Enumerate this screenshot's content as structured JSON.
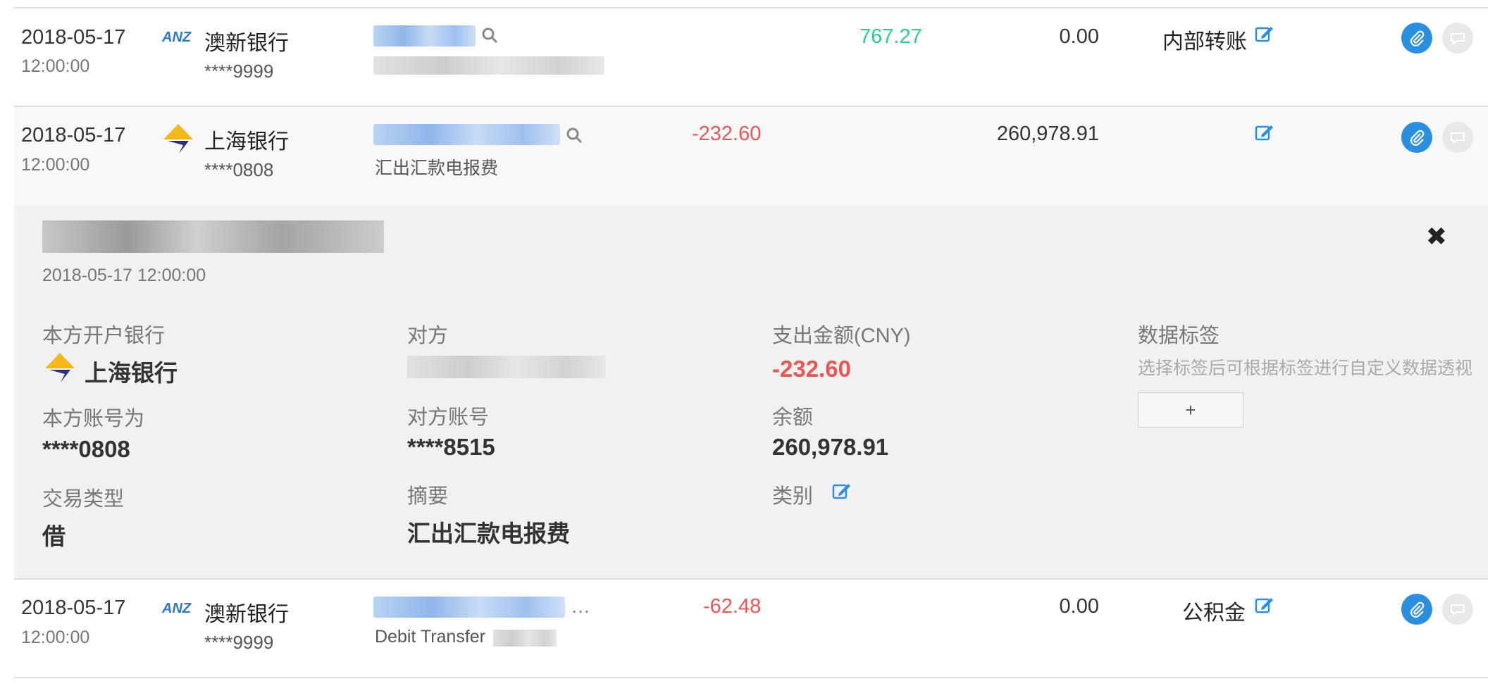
{
  "icons": {
    "anz_text": "ANZ",
    "edit": "edit-icon",
    "search": "search-icon",
    "attach": "paperclip-icon",
    "comment": "comment-icon",
    "close": "close-icon"
  },
  "colors": {
    "income": "#2ecc8a",
    "expense": "#e95656",
    "accent": "#2b8fe0"
  },
  "rows": [
    {
      "date": "2018-05-17",
      "time": "12:00:00",
      "bank": "澳新银行",
      "account": "****9999",
      "income": "767.27",
      "expense": "",
      "balance": "0.00",
      "category": "内部转账",
      "memo": ""
    },
    {
      "date": "2018-05-17",
      "time": "12:00:00",
      "bank": "上海银行",
      "account": "****0808",
      "income": "",
      "expense": "-232.60",
      "balance": "260,978.91",
      "category": "",
      "memo": "汇出汇款电报费"
    },
    {
      "date": "2018-05-17",
      "time": "12:00:00",
      "bank": "澳新银行",
      "account": "****9999",
      "income": "",
      "expense": "-62.48",
      "balance": "0.00",
      "category": "公积金",
      "memo": "Debit Transfer",
      "party_suffix": "…"
    }
  ],
  "detail": {
    "date": "2018-05-17 12:00:00",
    "own_bank_label": "本方开户银行",
    "own_bank": "上海银行",
    "own_account_label": "本方账号为",
    "own_account": "****0808",
    "txn_type_label": "交易类型",
    "txn_type": "借",
    "counterparty_label": "对方",
    "counterparty_account_label": "对方账号",
    "counterparty_account": "****8515",
    "summary_label": "摘要",
    "summary": "汇出汇款电报费",
    "amount_label": "支出金额(CNY)",
    "amount": "-232.60",
    "balance_label": "余额",
    "balance": "260,978.91",
    "category_label": "类别",
    "tags_label": "数据标签",
    "tags_hint": "选择标签后可根据标签进行自定义数据透视",
    "add_tag": "+",
    "close": "✖"
  }
}
